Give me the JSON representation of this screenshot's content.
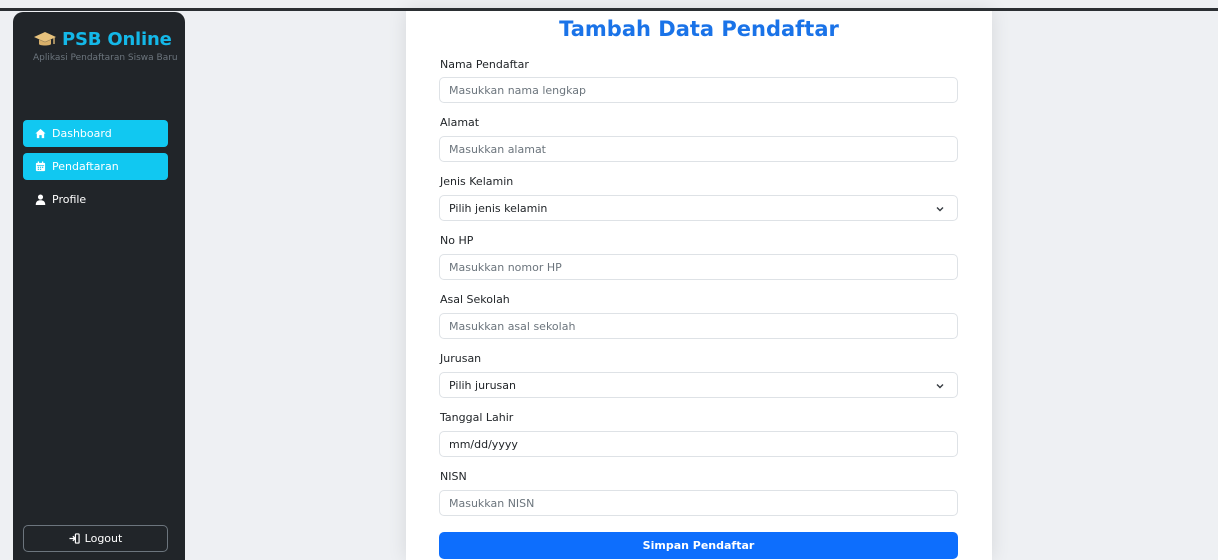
{
  "sidebar": {
    "brand": "PSB Online",
    "subtitle": "Aplikasi Pendaftaran Siswa Baru",
    "items": [
      {
        "label": "Dashboard",
        "icon": "home-icon",
        "active": true
      },
      {
        "label": "Pendaftaran",
        "icon": "calendar-icon",
        "active": true
      },
      {
        "label": "Profile",
        "icon": "user-icon",
        "active": false
      }
    ],
    "logout": "Logout"
  },
  "form": {
    "title": "Tambah Data Pendaftar",
    "fields": {
      "nama": {
        "label": "Nama Pendaftar",
        "placeholder": "Masukkan nama lengkap"
      },
      "alamat": {
        "label": "Alamat",
        "placeholder": "Masukkan alamat"
      },
      "jenis_kelamin": {
        "label": "Jenis Kelamin",
        "value": "Pilih jenis kelamin"
      },
      "no_hp": {
        "label": "No HP",
        "placeholder": "Masukkan nomor HP"
      },
      "asal_sekolah": {
        "label": "Asal Sekolah",
        "placeholder": "Masukkan asal sekolah"
      },
      "jurusan": {
        "label": "Jurusan",
        "value": "Pilih jurusan"
      },
      "tanggal_lahir": {
        "label": "Tanggal Lahir",
        "value": "mm/dd/yyyy"
      },
      "nisn": {
        "label": "NISN",
        "placeholder": "Masukkan NISN"
      }
    },
    "submit": "Simpan Pendaftar"
  },
  "colors": {
    "sidebar_bg": "#212529",
    "accent": "#11c8f1",
    "brand": "#14b8e8",
    "title": "#1a73e8",
    "primary_button": "#0d6efd"
  }
}
